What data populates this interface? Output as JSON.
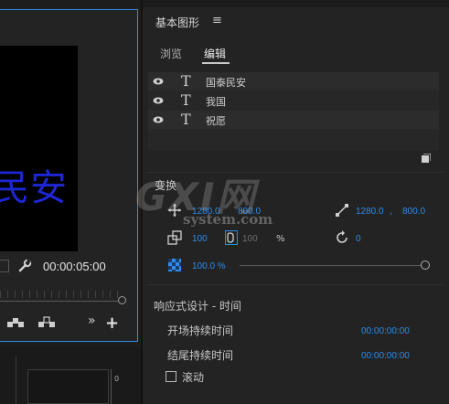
{
  "monitor": {
    "video_text": "民安",
    "timecode": "00:00:05:00"
  },
  "audio_meter": {
    "zero_label": "0"
  },
  "panel": {
    "title": "基本图形",
    "menu_icon": "hamburger-icon",
    "tabs": [
      {
        "label": "浏览",
        "active": false
      },
      {
        "label": "编辑",
        "active": true
      }
    ]
  },
  "layers": [
    {
      "name": "国泰民安",
      "visible": true
    },
    {
      "name": "我国",
      "visible": true
    },
    {
      "name": "祝愿",
      "visible": true
    }
  ],
  "transform": {
    "label": "变换",
    "position": {
      "x": "1280.0",
      "y": "800.0"
    },
    "anchor": {
      "x": "1280.0",
      "comma": ",",
      "y": "800.0"
    },
    "scale": {
      "value": "100",
      "height": "100",
      "unit": "%"
    },
    "rotation": "0",
    "opacity": "100.0 %"
  },
  "responsive": {
    "label": "响应式设计 - 时间",
    "intro_label": "开场持续时间",
    "intro_value": "00:00:00:00",
    "outro_label": "结尾持续时间",
    "outro_value": "00:00:00:00",
    "roll_label": "滚动"
  },
  "watermark": {
    "main": "GXI网",
    "sub": "system.com"
  },
  "colors": {
    "accent": "#2d8ceb",
    "video_text": "#1d27d6"
  }
}
